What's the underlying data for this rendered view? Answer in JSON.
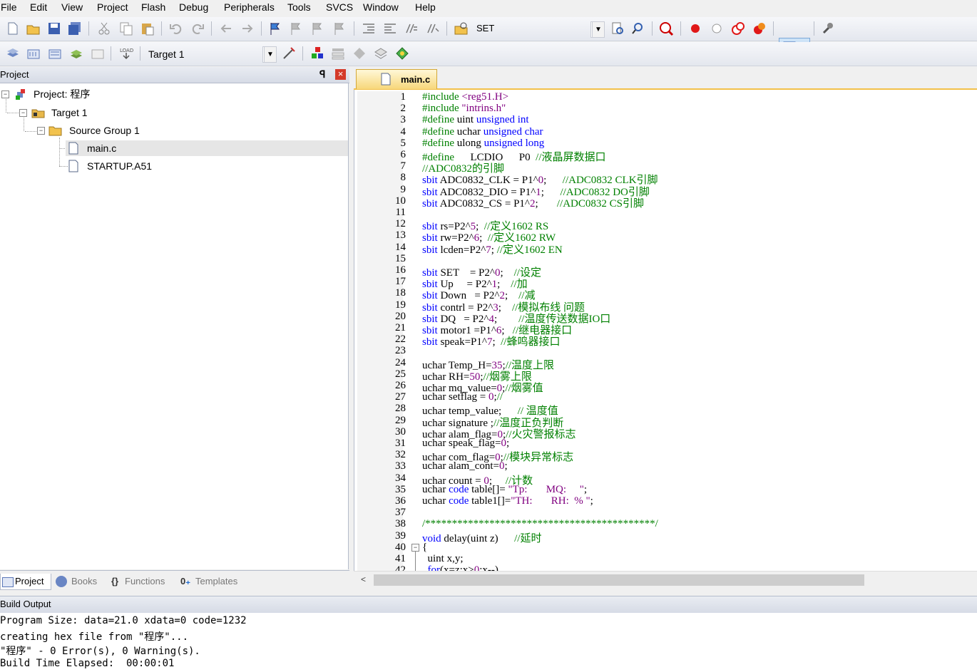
{
  "menu": [
    "File",
    "Edit",
    "View",
    "Project",
    "Flash",
    "Debug",
    "Peripherals",
    "Tools",
    "SVCS",
    "Window",
    "Help"
  ],
  "toolbar": {
    "find_value": "SET",
    "target": "Target 1",
    "load_label": "LOAD"
  },
  "project_panel": {
    "title": "Project",
    "pin": "ꟼ",
    "close": "×",
    "tree": {
      "project": "Project: 程序",
      "target": "Target 1",
      "group": "Source Group 1",
      "files": [
        "main.c",
        "STARTUP.A51"
      ]
    },
    "tabs": [
      "Project",
      "Books",
      "Functions",
      "Templates"
    ]
  },
  "editor": {
    "tab": "main.c",
    "lines": [
      "#include <reg51.H>",
      "#include \"intrins.h\"",
      "#define uint unsigned int",
      "#define uchar unsigned char",
      "#define ulong unsigned long",
      "#define      LCDIO      P0  //液晶屏数据口",
      "//ADC0832的引脚",
      "sbit ADC0832_CLK = P1^0;      //ADC0832 CLK引脚",
      "sbit ADC0832_DIO = P1^1;      //ADC0832 DO引脚",
      "sbit ADC0832_CS = P1^2;       //ADC0832 CS引脚",
      "",
      "sbit rs=P2^5;  //定义1602 RS",
      "sbit rw=P2^6;  //定义1602 RW",
      "sbit lcden=P2^7; //定义1602 EN",
      "",
      "sbit SET    = P2^0;    //设定",
      "sbit Up     = P2^1;    //加",
      "sbit Down   = P2^2;    //减",
      "sbit contrl = P2^3;    //模拟布线 问题",
      "sbit DQ   = P2^4;        //温度传送数据IO口",
      "sbit motor1 =P1^6;   //继电器接口",
      "sbit speak=P1^7;  //蜂鸣器接口",
      "",
      "uchar Temp_H=35;//温度上限",
      "uchar RH=50;//烟雾上限",
      "uchar mq_value=0;//烟雾值",
      "uchar setflag = 0;//",
      "uchar temp_value;      // 温度值",
      "uchar signature ;//温度正负判断",
      "uchar alam_flag=0;//火灾警报标志",
      "uchar speak_flag=0;",
      "uchar com_flag=0;//模块异常标志",
      "uchar alam_cont=0;",
      "uchar count = 0;     //计数",
      "uchar code table[]= \"Tp:       MQ:     \";",
      "uchar code table1[]=\"TH:       RH:  % \";",
      "",
      "/*******************************************/",
      "void delay(uint z)      //延时",
      "{",
      "  uint x,y;",
      "  for(x=z;x>0;x--)"
    ]
  },
  "build": {
    "title": "Build Output",
    "lines": [
      "Program Size: data=21.0 xdata=0 code=1232",
      "creating hex file from \"程序\"...",
      "\"程序\" - 0 Error(s), 0 Warning(s).",
      "Build Time Elapsed:  00:00:01"
    ]
  }
}
